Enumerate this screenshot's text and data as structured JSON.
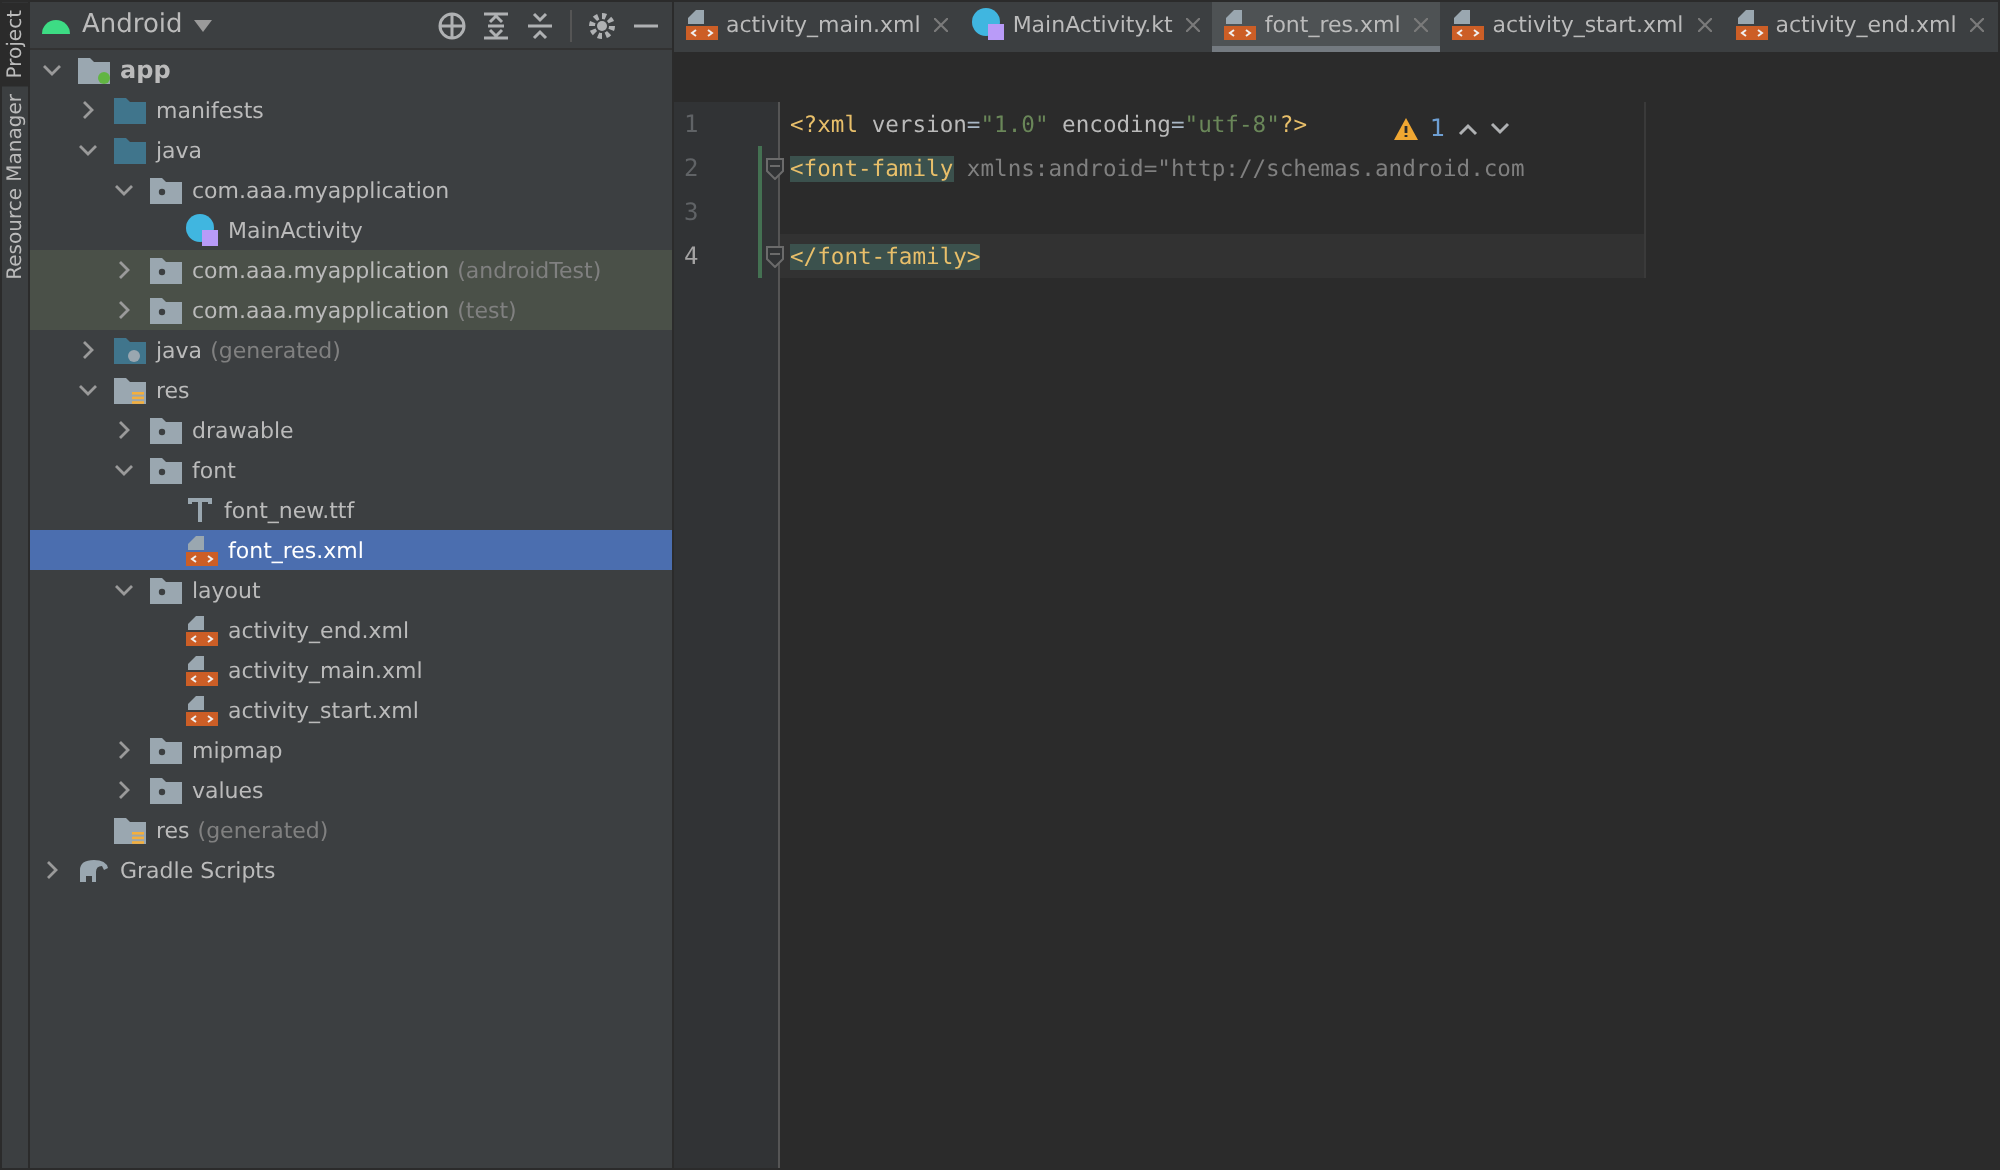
{
  "side_tabs": [
    {
      "label": "Project",
      "selected": true
    },
    {
      "label": "Resource Manager",
      "selected": false
    }
  ],
  "project_panel": {
    "view": "Android"
  },
  "tree": [
    {
      "label": "app",
      "kind": "module",
      "bold": true,
      "expanded": true,
      "selected": false,
      "tinted": false,
      "children": [
        {
          "label": "manifests",
          "kind": "folder",
          "expanded": false,
          "selected": false,
          "tinted": false
        },
        {
          "label": "java",
          "kind": "folder",
          "expanded": true,
          "selected": false,
          "tinted": false,
          "children": [
            {
              "label": "com.aaa.myapplication",
              "kind": "package",
              "expanded": true,
              "selected": false,
              "tinted": false,
              "children": [
                {
                  "label": "MainActivity",
                  "kind": "kotlin",
                  "selected": false,
                  "tinted": false
                }
              ]
            },
            {
              "label": "com.aaa.myapplication",
              "suffix": "(androidTest)",
              "kind": "package",
              "expanded": false,
              "selected": false,
              "tinted": true
            },
            {
              "label": "com.aaa.myapplication",
              "suffix": "(test)",
              "kind": "package",
              "expanded": false,
              "selected": false,
              "tinted": true
            }
          ]
        },
        {
          "label": "java",
          "suffix": "(generated)",
          "kind": "generated",
          "expanded": false,
          "selected": false,
          "tinted": false
        },
        {
          "label": "res",
          "kind": "res",
          "expanded": true,
          "selected": false,
          "tinted": false,
          "children": [
            {
              "label": "drawable",
              "kind": "package",
              "expanded": false,
              "selected": false,
              "tinted": false
            },
            {
              "label": "font",
              "kind": "package",
              "expanded": true,
              "selected": false,
              "tinted": false,
              "children": [
                {
                  "label": "font_new.ttf",
                  "kind": "ttf",
                  "selected": false,
                  "tinted": false
                },
                {
                  "label": "font_res.xml",
                  "kind": "xml",
                  "selected": true,
                  "tinted": false
                }
              ]
            },
            {
              "label": "layout",
              "kind": "package",
              "expanded": true,
              "selected": false,
              "tinted": false,
              "children": [
                {
                  "label": "activity_end.xml",
                  "kind": "xml",
                  "selected": false,
                  "tinted": false
                },
                {
                  "label": "activity_main.xml",
                  "kind": "xml",
                  "selected": false,
                  "tinted": false
                },
                {
                  "label": "activity_start.xml",
                  "kind": "xml",
                  "selected": false,
                  "tinted": false
                }
              ]
            },
            {
              "label": "mipmap",
              "kind": "package",
              "expanded": false,
              "selected": false,
              "tinted": false
            },
            {
              "label": "values",
              "kind": "package",
              "expanded": false,
              "selected": false,
              "tinted": false
            }
          ]
        },
        {
          "label": "res",
          "suffix": "(generated)",
          "kind": "res",
          "selected": false,
          "tinted": false
        }
      ]
    },
    {
      "label": "Gradle Scripts",
      "kind": "gradle",
      "expanded": false,
      "selected": false,
      "tinted": false
    }
  ],
  "editor_tabs": [
    {
      "label": "activity_main.xml",
      "kind": "xml",
      "selected": false
    },
    {
      "label": "MainActivity.kt",
      "kind": "kotlin",
      "selected": false
    },
    {
      "label": "font_res.xml",
      "kind": "xml",
      "selected": true
    },
    {
      "label": "activity_start.xml",
      "kind": "xml",
      "selected": false
    },
    {
      "label": "activity_end.xml",
      "kind": "xml",
      "selected": false
    }
  ],
  "inspection": {
    "warnings": "1"
  },
  "code_lines": [
    {
      "number": "1",
      "current": false,
      "fold": false,
      "changed": false,
      "tokens": [
        {
          "text": "<?xml ",
          "kind": "tag"
        },
        {
          "text": "version",
          "kind": "attr"
        },
        {
          "text": "=",
          "kind": "plain"
        },
        {
          "text": "\"1.0\"",
          "kind": "value"
        },
        {
          "text": " encoding",
          "kind": "attr"
        },
        {
          "text": "=",
          "kind": "plain"
        },
        {
          "text": "\"utf-8\"",
          "kind": "value"
        },
        {
          "text": "?>",
          "kind": "tag"
        }
      ]
    },
    {
      "number": "2",
      "current": false,
      "fold": true,
      "changed": true,
      "tokens": [
        {
          "text": "<font-family",
          "kind": "tag",
          "matched": true
        },
        {
          "text": " xmlns:android=\"http://schemas.android.com",
          "kind": "unused"
        }
      ]
    },
    {
      "number": "3",
      "current": false,
      "fold": false,
      "changed": true
    },
    {
      "number": "4",
      "current": true,
      "fold": true,
      "changed": true,
      "tokens": [
        {
          "text": "</font-family>",
          "kind": "tag",
          "matched": true
        }
      ]
    }
  ]
}
